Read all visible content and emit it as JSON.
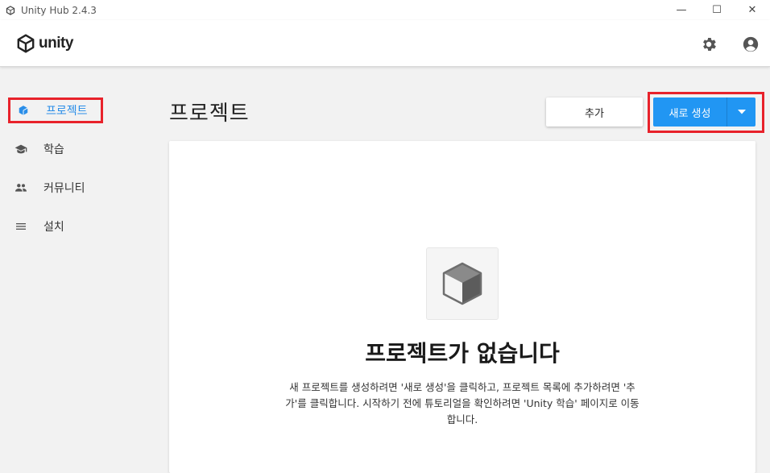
{
  "window": {
    "title": "Unity Hub 2.4.3",
    "minimize": "—",
    "maximize": "☐",
    "close": "✕"
  },
  "appbar": {
    "logo_text": "unity",
    "settings_icon": "gear-icon",
    "account_icon": "account-circle-icon"
  },
  "sidebar": {
    "items": [
      {
        "label": "프로젝트",
        "icon": "cube-icon",
        "active": true
      },
      {
        "label": "학습",
        "icon": "graduation-cap-icon",
        "active": false
      },
      {
        "label": "커뮤니티",
        "icon": "people-icon",
        "active": false
      },
      {
        "label": "설치",
        "icon": "list-icon",
        "active": false
      }
    ]
  },
  "main": {
    "title": "프로젝트",
    "add_label": "추가",
    "new_label": "새로 생성",
    "empty_title": "프로젝트가 없습니다",
    "empty_desc": "새 프로젝트를 생성하려면 '새로 생성'을 클릭하고, 프로젝트 목록에 추가하려면 '추가'를 클릭합니다. 시작하기 전에 튜토리얼을 확인하려면 'Unity 학습' 페이지로 이동합니다."
  },
  "colors": {
    "accent": "#2196f3",
    "highlight": "#e8222b",
    "active_text": "#2a8ee8"
  }
}
